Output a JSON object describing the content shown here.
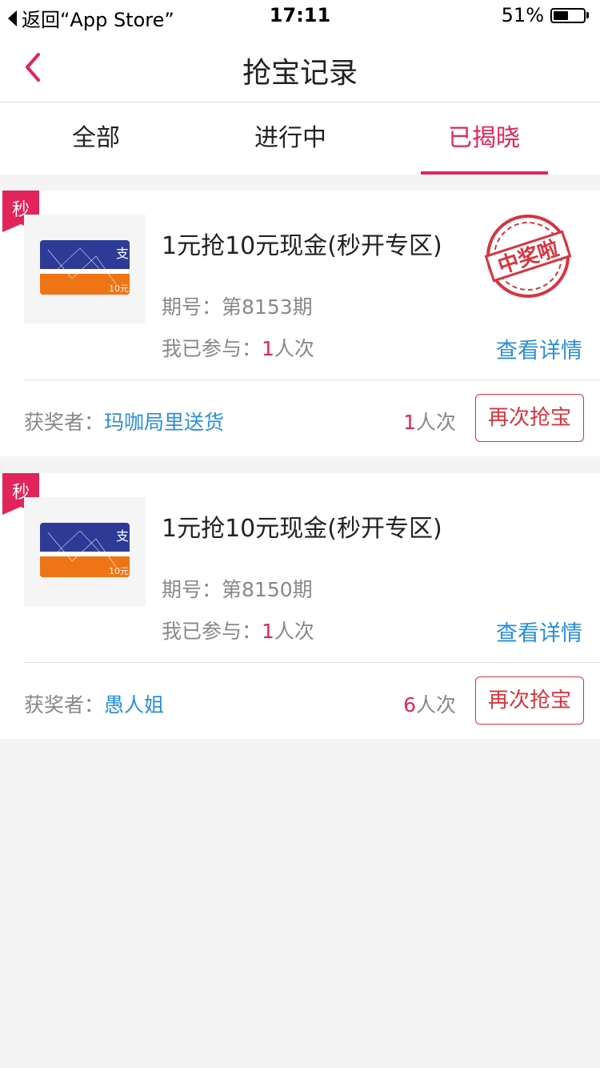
{
  "status_bar": {
    "back_label": "返回“App Store”",
    "time": "17:11",
    "battery_text": "51%",
    "battery_level": 0.51
  },
  "nav": {
    "title": "抢宝记录",
    "back_icon": "chevron-left-icon",
    "accent_color": "#e2245a"
  },
  "tabs": [
    {
      "label": "全部",
      "active": false
    },
    {
      "label": "进行中",
      "active": false
    },
    {
      "label": "已揭晓",
      "active": true
    }
  ],
  "records": [
    {
      "badge": "秒",
      "thumb_icon": "alipay-card-icon",
      "thumb_caption": "10元",
      "thumb_symbol": "支",
      "title": "1元抢10元现金(秒开专区)",
      "issue_label": "期号：",
      "issue_value": "第8153期",
      "joined_label": "我已参与：",
      "joined_count": "1",
      "joined_unit": "人次",
      "detail_link": "查看详情",
      "winner_label": "获奖者：",
      "winner_name": "玛咖局里送货",
      "winner_count": "1",
      "winner_unit": "人次",
      "again_button": "再次抢宝",
      "stamp_text": "中奖啦",
      "won": true
    },
    {
      "badge": "秒",
      "thumb_icon": "alipay-card-icon",
      "thumb_caption": "10元",
      "thumb_symbol": "支",
      "title": "1元抢10元现金(秒开专区)",
      "issue_label": "期号：",
      "issue_value": "第8150期",
      "joined_label": "我已参与：",
      "joined_count": "1",
      "joined_unit": "人次",
      "detail_link": "查看详情",
      "winner_label": "获奖者：",
      "winner_name": "愚人姐",
      "winner_count": "6",
      "winner_unit": "人次",
      "again_button": "再次抢宝",
      "won": false
    }
  ]
}
